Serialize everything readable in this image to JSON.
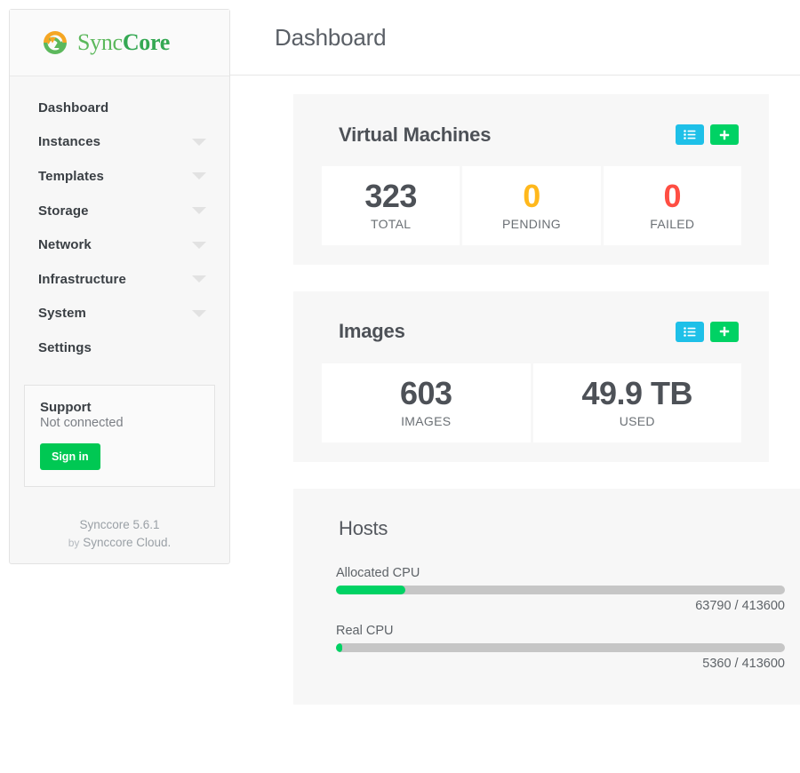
{
  "brand": {
    "logo_icon": "sync-circular-arrows-icon",
    "name_part1": "Sync",
    "name_part2": "Core"
  },
  "sidebar": {
    "items": [
      {
        "label": "Dashboard",
        "has_caret": false
      },
      {
        "label": "Instances",
        "has_caret": true
      },
      {
        "label": "Templates",
        "has_caret": true
      },
      {
        "label": "Storage",
        "has_caret": true
      },
      {
        "label": "Network",
        "has_caret": true
      },
      {
        "label": "Infrastructure",
        "has_caret": true
      },
      {
        "label": "System",
        "has_caret": true
      },
      {
        "label": "Settings",
        "has_caret": false
      }
    ],
    "support": {
      "title": "Support",
      "status": "Not connected",
      "signin_label": "Sign in"
    },
    "footer": {
      "version": "Synccore 5.6.1",
      "by_word": "by",
      "vendor": "Synccore Cloud."
    }
  },
  "header": {
    "title": "Dashboard"
  },
  "cards": {
    "virtual_machines": {
      "title": "Virtual Machines",
      "list_icon": "list-icon",
      "add_icon": "plus-icon",
      "stats": [
        {
          "value": "323",
          "label": "TOTAL",
          "color": "#4d5157"
        },
        {
          "value": "0",
          "label": "PENDING",
          "color": "#ffb81c"
        },
        {
          "value": "0",
          "label": "FAILED",
          "color": "#ff4e43"
        }
      ]
    },
    "images": {
      "title": "Images",
      "list_icon": "list-icon",
      "add_icon": "plus-icon",
      "stats": [
        {
          "value": "603",
          "label": "IMAGES",
          "color": "#4d5157"
        },
        {
          "value": "49.9 TB",
          "label": "USED",
          "color": "#4d5157"
        }
      ]
    },
    "hosts": {
      "title": "Hosts",
      "bars": [
        {
          "label": "Allocated CPU",
          "value_text": "63790 / 413600",
          "used": 63790,
          "total": 413600,
          "percent": 15.4
        },
        {
          "label": "Real CPU",
          "value_text": "5360 / 413600",
          "used": 5360,
          "total": 413600,
          "percent": 1.3
        }
      ]
    }
  },
  "colors": {
    "brand_green": "#34a853",
    "accent_cyan": "#1ec0e8",
    "accent_green": "#00d264",
    "warning": "#ffb81c",
    "danger": "#ff4e43"
  }
}
